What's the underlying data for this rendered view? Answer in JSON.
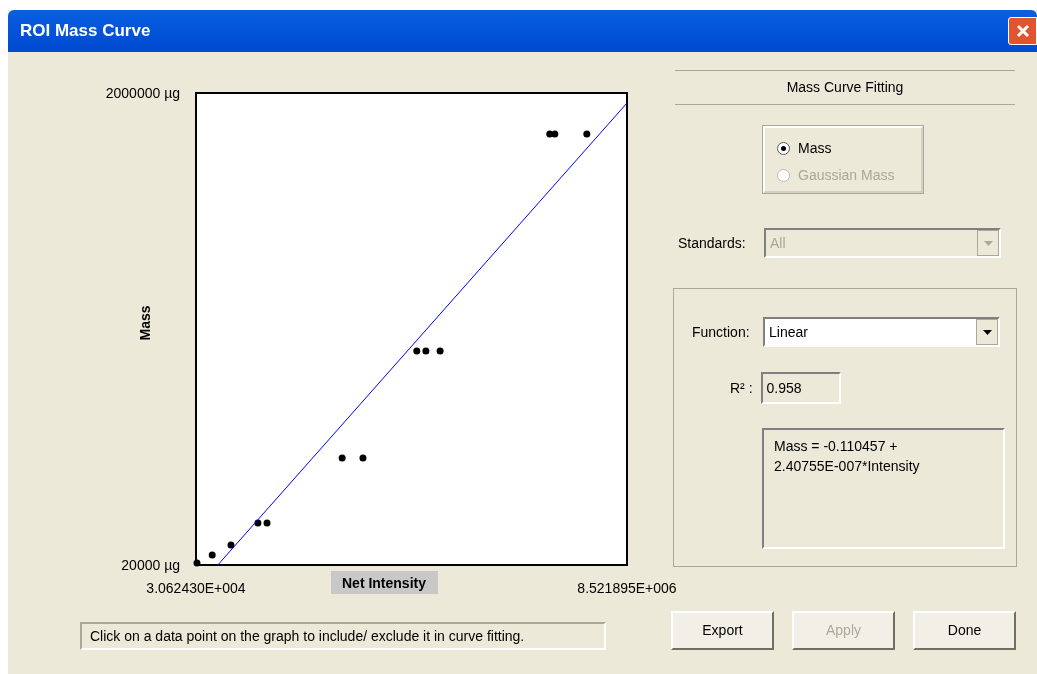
{
  "window": {
    "title": "ROI Mass Curve"
  },
  "chart": {
    "chart_data": {
      "type": "scatter",
      "xlabel": "Net Intensity",
      "ylabel": "Mass",
      "xlim": [
        30624.3,
        8521895
      ],
      "ylim": [
        20000,
        2000000
      ],
      "xticks": [
        {
          "value": 30624.3,
          "label": "3.062430E+004"
        },
        {
          "value": 8521895,
          "label": "8.521895E+006"
        }
      ],
      "yticks": [
        {
          "value": 2000000,
          "label": "2000000 µg"
        },
        {
          "value": 20000,
          "label": "20000 µg"
        }
      ],
      "series": [
        {
          "color": "#000000",
          "x": [
            50000,
            350000,
            720000,
            1250000,
            1430000,
            2910000,
            3320000,
            4380000,
            4560000,
            4840000,
            7000000,
            7100000,
            7730000
          ],
          "values": [
            28000,
            62000,
            104000,
            196000,
            196000,
            469000,
            469000,
            918000,
            918000,
            918000,
            1828000,
            1828000,
            1828000
          ]
        },
        {
          "type": "line",
          "color": "#0000ff",
          "x": [
            460000,
            8521895
          ],
          "values": [
            20000,
            1958000
          ]
        }
      ]
    }
  },
  "status": "Click on a data point on the graph to include/ exclude it in curve fitting.",
  "fitting": {
    "title": "Mass Curve Fitting",
    "radios": [
      {
        "label": "Mass",
        "selected": true,
        "disabled": false
      },
      {
        "label": "Gaussian Mass",
        "selected": false,
        "disabled": true
      }
    ],
    "standards": {
      "label": "Standards:",
      "value": "All",
      "disabled": true
    },
    "function": {
      "label": "Function:",
      "value": "Linear",
      "disabled": false
    },
    "r2": {
      "label": "R² :",
      "value": "0.958"
    },
    "equation": [
      "Mass = -0.110457 +",
      "2.40755E-007*Intensity"
    ]
  },
  "buttons": [
    {
      "label": "Export",
      "disabled": false
    },
    {
      "label": "Apply",
      "disabled": true
    },
    {
      "label": "Done",
      "disabled": false
    }
  ]
}
